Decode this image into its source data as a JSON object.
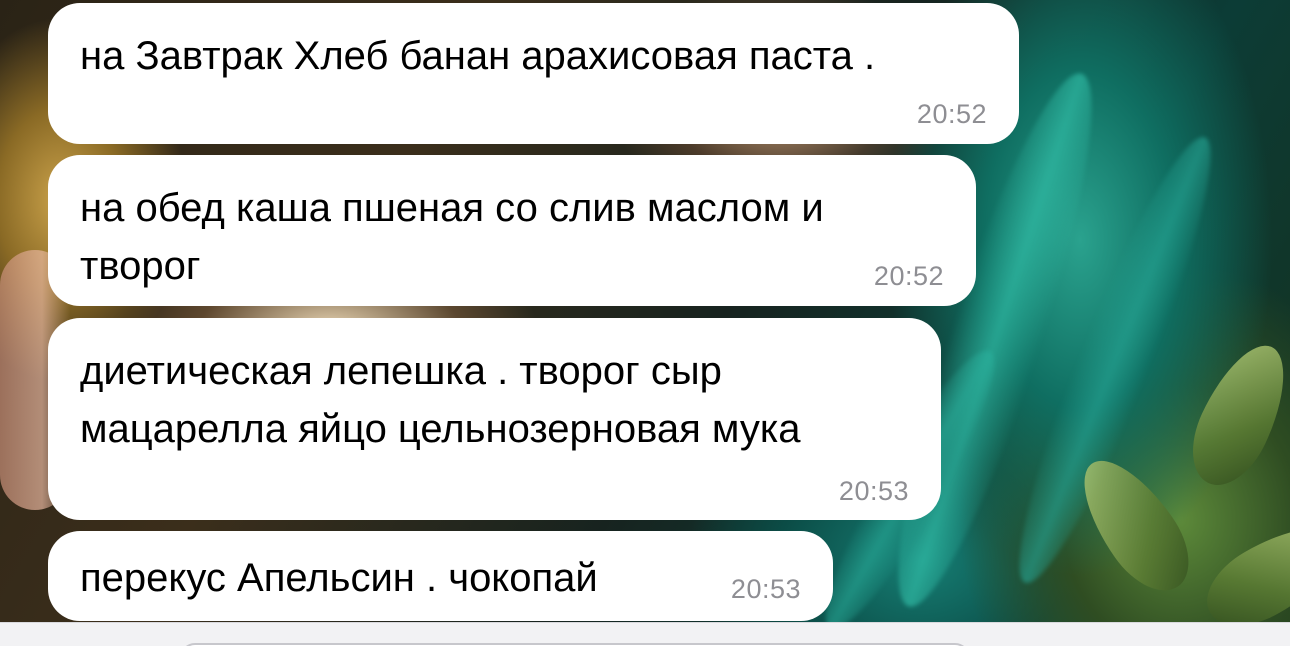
{
  "chat": {
    "messages": [
      {
        "text": "на Завтрак Хлеб банан арахисовая паста .",
        "time": "20:52"
      },
      {
        "text": "на обед каша пшеная со слив маслом и\nтворог",
        "time": "20:52"
      },
      {
        "text": "диетическая лепешка . творог сыр\nмацарелла яйцо цельнозерновая мука",
        "time": "20:53"
      },
      {
        "text": "перекус Апельсин . чокопай",
        "time": "20:53"
      }
    ]
  },
  "colors": {
    "bubble_background": "#ffffff",
    "timestamp": "#8e8e93",
    "input_bar": "#f2f2f4"
  }
}
